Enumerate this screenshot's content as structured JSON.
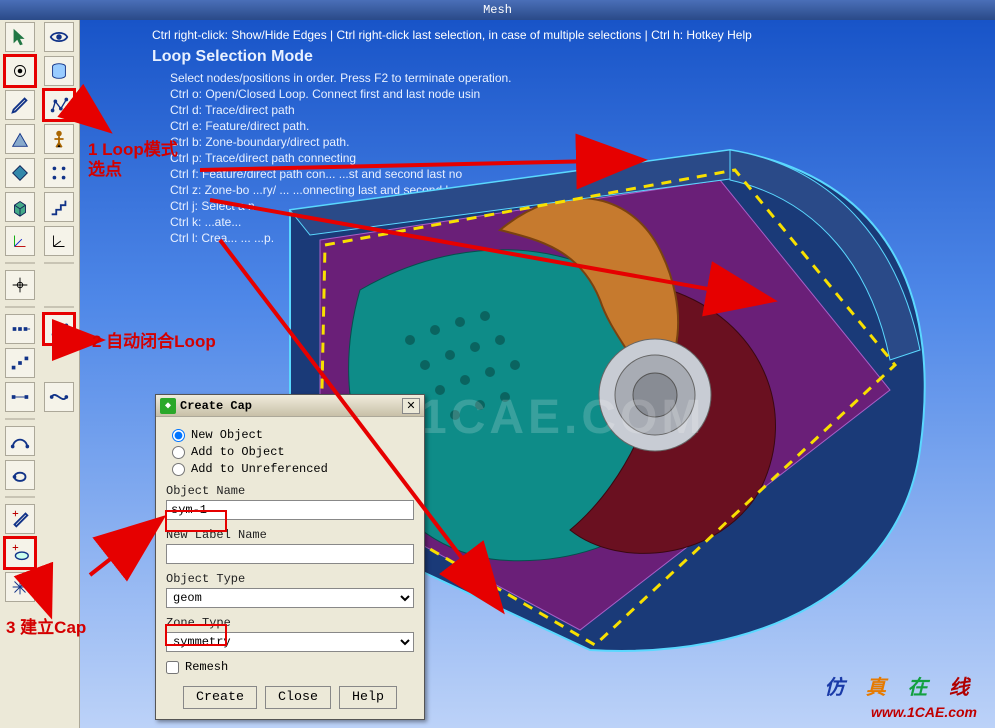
{
  "titlebar": {
    "title": "Mesh"
  },
  "hints": {
    "top": "Ctrl right-click: Show/Hide Edges | Ctrl right-click last selection, in case of multiple selections | Ctrl h: Hotkey Help",
    "mode": "Loop Selection Mode",
    "lines": [
      "Select nodes/positions in order. Press F2 to terminate operation.",
      "Ctrl o: Open/Closed Loop. Connect first and last node usin",
      "Ctrl d: Trace/direct path",
      "Ctrl e: Feature/direct path.",
      "Ctrl b: Zone-boundary/direct path.",
      "Ctrl p: Trace/direct path connecting",
      "Ctrl f: Feature/direct path con...        ...st and second last no",
      "Ctrl z: Zone-bo   ...ry/   ...   ...onnecting last and second last n...",
      "Ctrl j: Select a   n...",
      "Ctrl k: ...ate...",
      "Ctrl l: Crea...   ...  ...p."
    ]
  },
  "annotations": {
    "a1_l1": "1 Loop模式",
    "a1_l2": "选点",
    "a2": "2 自动闭合Loop",
    "a3": "3 建立Cap"
  },
  "dialog": {
    "title": "Create Cap",
    "radio": {
      "r1": "New Object",
      "r2": "Add to Object",
      "r3": "Add to Unreferenced"
    },
    "labels": {
      "objname": "Object Name",
      "newlabel": "New Label Name",
      "objtype": "Object Type",
      "zonetype": "Zone Type"
    },
    "values": {
      "objname": "sym-1",
      "newlabel": "",
      "objtype": "geom",
      "zonetype": "symmetry"
    },
    "remesh": "Remesh",
    "buttons": {
      "create": "Create",
      "close": "Close",
      "help": "Help"
    }
  },
  "footer": {
    "cn1": "仿",
    "cn2": "真",
    "cn3": "在",
    "cn4": "线",
    "url": "www.1CAE.com"
  },
  "watermark": "1CAE.COM",
  "icons": {
    "arrow": "arrow",
    "eye": "eye",
    "dot": "dot",
    "cyl": "cylinder",
    "pencil": "pencil",
    "poly": "polyline",
    "tri": "triangle",
    "person": "human",
    "gem": "rhombus",
    "block": "block",
    "axis": "axis",
    "axes": "axes",
    "cursor": "cursor",
    "loop": "loop",
    "cap": "cap",
    "curve": "curve",
    "polycurve": "polycurve",
    "eraser": "eraser",
    "transform": "transform",
    "plus-dot": "plus-dot",
    "nodes": "nodes-row",
    "nodes-diag": "nodes-diag",
    "nodes-line": "nodes-line",
    "stairs": "stairs",
    "cable": "cable"
  }
}
